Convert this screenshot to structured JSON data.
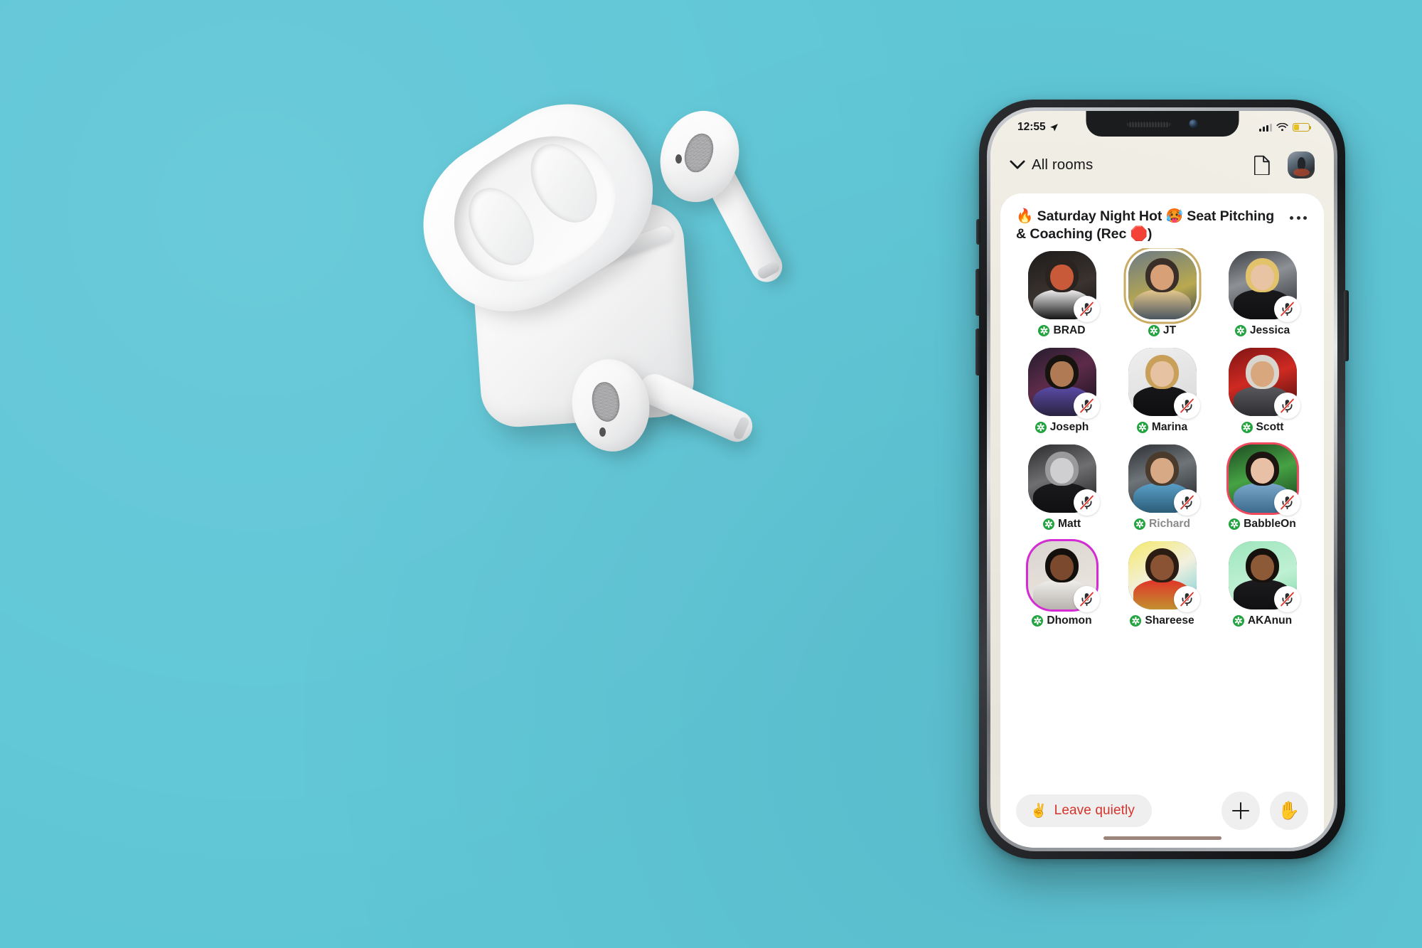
{
  "scene": {
    "background_color": "#5fc6d6",
    "objects": [
      "airpods-case",
      "airpod-left",
      "airpod-right",
      "iphone"
    ]
  },
  "phone": {
    "status_bar": {
      "time": "12:55",
      "location_icon": "location-arrow-icon",
      "cellular_icon": "cellular-signal-icon",
      "wifi_icon": "wifi-icon",
      "battery_icon": "battery-low-power-icon",
      "battery_color": "#e8bf1e",
      "battery_level_percent": 35
    },
    "nav_bar": {
      "back_chevron_icon": "chevron-down-icon",
      "back_label": "All rooms",
      "notes_icon": "document-icon",
      "profile_avatar": "user-avatar"
    },
    "room": {
      "title": "🔥 Saturday Night Hot 🥵 Seat Pitching & Coaching (Rec 🛑)",
      "more_icon": "ellipsis-icon",
      "participants": [
        {
          "name": "BRAD",
          "muted": true,
          "speaking": false,
          "ring": "none",
          "name_dim": false,
          "badge": "green-star"
        },
        {
          "name": "JT",
          "muted": false,
          "speaking": true,
          "ring": "gold",
          "name_dim": false,
          "badge": "green-star"
        },
        {
          "name": "Jessica",
          "muted": true,
          "speaking": false,
          "ring": "none",
          "name_dim": false,
          "badge": "green-star"
        },
        {
          "name": "Joseph",
          "muted": true,
          "speaking": false,
          "ring": "none",
          "name_dim": false,
          "badge": "green-star"
        },
        {
          "name": "Marina",
          "muted": true,
          "speaking": false,
          "ring": "none",
          "name_dim": false,
          "badge": "green-star"
        },
        {
          "name": "Scott",
          "muted": true,
          "speaking": false,
          "ring": "none",
          "name_dim": false,
          "badge": "green-star"
        },
        {
          "name": "Matt",
          "muted": true,
          "speaking": false,
          "ring": "none",
          "name_dim": false,
          "badge": "green-star"
        },
        {
          "name": "Richard",
          "muted": true,
          "speaking": false,
          "ring": "none",
          "name_dim": true,
          "badge": "green-star"
        },
        {
          "name": "BabbleOn",
          "muted": true,
          "speaking": false,
          "ring": "red",
          "name_dim": false,
          "badge": "green-star"
        },
        {
          "name": "Dhomon",
          "muted": true,
          "speaking": false,
          "ring": "pink",
          "name_dim": false,
          "badge": "green-star"
        },
        {
          "name": "Shareese",
          "muted": true,
          "speaking": false,
          "ring": "none",
          "name_dim": false,
          "badge": "green-star"
        },
        {
          "name": "AKAnun",
          "muted": true,
          "speaking": false,
          "ring": "none",
          "name_dim": false,
          "badge": "green-star"
        }
      ]
    },
    "bottom_bar": {
      "leave_emoji": "✌️",
      "leave_label": "Leave quietly",
      "leave_color": "#d6342b",
      "add_icon": "plus-icon",
      "raise_hand_icon": "raised-hand-icon",
      "raise_hand_emoji": "✋"
    },
    "home_indicator": "home-indicator"
  }
}
